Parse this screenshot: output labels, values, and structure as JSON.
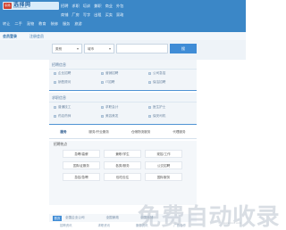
{
  "header": {
    "logo_mark": "职场",
    "logo_text": "选择网",
    "logo_url": "www.xuanze.com",
    "nav_row1": [
      "招聘",
      "求职",
      "培训",
      "兼职",
      "商业",
      "外包"
    ],
    "nav_row2": [
      "商铺",
      "厂房",
      "写字",
      "出租",
      "买卖",
      "家政"
    ],
    "nav_row3": [
      "转让",
      "二手",
      "宠物",
      "教育",
      "装修",
      "服务",
      "旅游"
    ]
  },
  "login": {
    "welcome": "会员登录",
    "register": "注册会员"
  },
  "search": {
    "select1": "类别",
    "select2": "城市",
    "button": "搜"
  },
  "panel1": {
    "title": "招聘信息",
    "items": [
      "企业招聘",
      "营销招聘",
      "公司急招",
      "销售顾问",
      "IT招聘",
      "保洁招聘"
    ]
  },
  "panel2": {
    "title": "求职信息",
    "items": [
      "普通技工",
      "求职会计",
      "医生护士",
      "药店药师",
      "美容美发",
      "保安司机"
    ]
  },
  "tabs": [
    "服务",
    "服务/开业服务",
    "仓储物流服务",
    "代理服务"
  ],
  "hot": {
    "title": "招聘热点",
    "items": [
      "急聘/高薪",
      "兼职/学生",
      "现招/工作",
      "国际证服务",
      "各类/服务",
      "公交招聘",
      "急招/急聘",
      "包吃包住",
      "国际服务"
    ]
  },
  "bottom": {
    "tag": "首页",
    "links": [
      "全国企业公司",
      "全国家政",
      "全国商铺"
    ],
    "footer": [
      "招聘资讯",
      "求职资讯",
      "服务资讯",
      "广告合作"
    ]
  },
  "watermark": {
    "text": "免费自动收录",
    "url": "www.xxxx.com"
  },
  "colors": {
    "header": "#3b87c7",
    "accent": "#3f8cd6",
    "panel": "#f1f5f9"
  }
}
